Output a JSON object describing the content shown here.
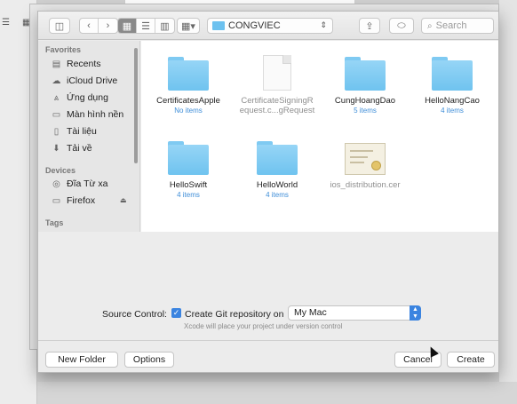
{
  "toolbar": {
    "view_buttons": [
      "icon-view",
      "list-view",
      "column-view"
    ],
    "path_folder": "CONGVIEC",
    "search_placeholder": "Search"
  },
  "sidebar": {
    "favorites_heading": "Favorites",
    "favorites": [
      {
        "label": "Recents",
        "icon": "recents-icon"
      },
      {
        "label": "iCloud Drive",
        "icon": "cloud-icon"
      },
      {
        "label": "Ứng dụng",
        "icon": "applications-icon"
      },
      {
        "label": "Màn hình nền",
        "icon": "desktop-icon"
      },
      {
        "label": "Tài liệu",
        "icon": "documents-icon"
      },
      {
        "label": "Tải về",
        "icon": "downloads-icon"
      }
    ],
    "devices_heading": "Devices",
    "devices": [
      {
        "label": "Đĩa Từ xa",
        "icon": "disk-icon"
      },
      {
        "label": "Firefox",
        "icon": "drive-icon"
      }
    ],
    "tags_heading": "Tags"
  },
  "files": [
    {
      "name": "CertificatesApple",
      "sub": "No items",
      "kind": "folder"
    },
    {
      "name": "CertificateSigningR equest.c...gRequest",
      "sub": "",
      "kind": "document"
    },
    {
      "name": "CungHoangDao",
      "sub": "5 items",
      "kind": "folder"
    },
    {
      "name": "HelloNangCao",
      "sub": "4 items",
      "kind": "folder"
    },
    {
      "name": "HelloSwift",
      "sub": "4 items",
      "kind": "folder"
    },
    {
      "name": "HelloWorld",
      "sub": "4 items",
      "kind": "folder"
    },
    {
      "name": "ios_distribution.cer",
      "sub": "",
      "kind": "certificate"
    }
  ],
  "source_control": {
    "label": "Source Control:",
    "checkbox_label": "Create Git repository on",
    "checked": true,
    "selected": "My Mac",
    "hint": "Xcode will place your project under version control"
  },
  "footer": {
    "new_folder": "New Folder",
    "options": "Options",
    "cancel": "Cancel",
    "create": "Create"
  },
  "colors": {
    "accent": "#3b84e0",
    "folder": "#6fc3ef",
    "item_count": "#3f8ed8"
  }
}
